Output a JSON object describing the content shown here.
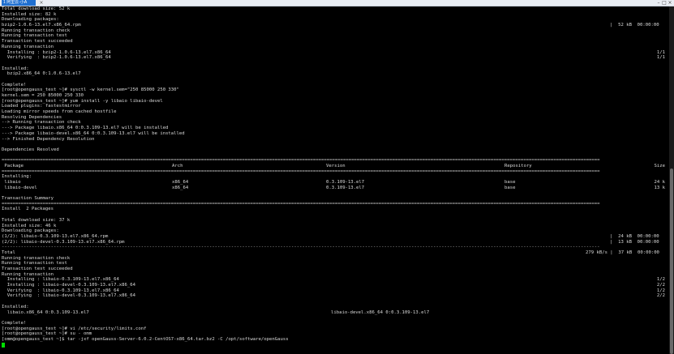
{
  "window": {
    "tab_title": "1 阿里云-小A",
    "tab_close": "×",
    "buttons": [
      "–",
      "□",
      "×"
    ]
  },
  "terminal": {
    "lines": [
      {
        "t": "Total download size: 52 k"
      },
      {
        "t": "Installed size: 82 k"
      },
      {
        "t": "Downloading packages:"
      },
      {
        "t": "bzip2-1.0.6-13.el7.x86_64.rpm",
        "c": [
          [
            750,
            "|  52 kB  00:00:00"
          ]
        ]
      },
      {
        "t": "Running transaction check"
      },
      {
        "t": "Running transaction test"
      },
      {
        "t": "Transaction test succeeded"
      },
      {
        "t": "Running transaction"
      },
      {
        "t": "  Installing : bzip2-1.0.6-13.el7.x86_64",
        "r": "1/1"
      },
      {
        "t": "  Verifying  : bzip2-1.0.6-13.el7.x86_64",
        "r": "1/1"
      },
      {
        "t": ""
      },
      {
        "t": "Installed:"
      },
      {
        "t": "  bzip2.x86_64 0:1.0.6-13.el7"
      },
      {
        "t": ""
      },
      {
        "t": "Complete!"
      },
      {
        "t": "[root@opengauss_test ~]# sysctl -w kernel.sem=\"250 85000 250 330\""
      },
      {
        "t": "kernel.sem = 250 85000 250 330"
      },
      {
        "t": "[root@opengauss_test ~]# yum install -y libaio libaio-devel"
      },
      {
        "t": "Loaded plugins: fastestmirror"
      },
      {
        "t": "Loading mirror speeds from cached hostfile"
      },
      {
        "t": "Resolving Dependencies"
      },
      {
        "t": "--> Running transaction check"
      },
      {
        "t": "---> Package libaio.x86_64 0:0.3.109-13.el7 will be installed"
      },
      {
        "t": "---> Package libaio-devel.x86_64 0:0.3.109-13.el7 will be installed"
      },
      {
        "t": "--> Finished Dependency Resolution"
      },
      {
        "t": ""
      },
      {
        "t": "Dependencies Resolved"
      },
      {
        "t": ""
      },
      {
        "t": "===========================================================================================================================================================================================================================",
        "sep": true
      },
      {
        "t": " Package",
        "c": [
          [
            210,
            "Arch"
          ],
          [
            400,
            "Version"
          ],
          [
            620,
            "Repository"
          ]
        ],
        "r": "Size"
      },
      {
        "t": "===========================================================================================================================================================================================================================",
        "sep": true
      },
      {
        "t": "Installing:"
      },
      {
        "t": " libaio",
        "c": [
          [
            210,
            "x86_64"
          ],
          [
            400,
            "0.3.109-13.el7"
          ],
          [
            620,
            "base"
          ]
        ],
        "r": "24 k"
      },
      {
        "t": " libaio-devel",
        "c": [
          [
            210,
            "x86_64"
          ],
          [
            400,
            "0.3.109-13.el7"
          ],
          [
            620,
            "base"
          ]
        ],
        "r": "13 k"
      },
      {
        "t": ""
      },
      {
        "t": "Transaction Summary"
      },
      {
        "t": "===========================================================================================================================================================================================================================",
        "sep": true
      },
      {
        "t": "Install  2 Packages"
      },
      {
        "t": ""
      },
      {
        "t": "Total download size: 37 k"
      },
      {
        "t": "Installed size: 46 k"
      },
      {
        "t": "Downloading packages:"
      },
      {
        "t": "(1/2): libaio-0.3.109-13.el7.x86_64.rpm",
        "c": [
          [
            750,
            "|  24 kB  00:00:00"
          ]
        ]
      },
      {
        "t": "(2/2): libaio-devel-0.3.109-13.el7.x86_64.rpm",
        "c": [
          [
            750,
            "|  13 kB  00:00:00"
          ]
        ]
      },
      {
        "t": "---------------------------------------------------------------------------------------------------------------------------------------------------------------------------------------------------------------------------",
        "sep": true
      },
      {
        "t": "Total",
        "c": [
          [
            720,
            "279 kB/s |  37 kB  00:00:00"
          ]
        ]
      },
      {
        "t": "Running transaction check"
      },
      {
        "t": "Running transaction test"
      },
      {
        "t": "Transaction test succeeded"
      },
      {
        "t": "Running transaction"
      },
      {
        "t": "  Installing : libaio-0.3.109-13.el7.x86_64",
        "r": "1/2"
      },
      {
        "t": "  Installing : libaio-devel-0.3.109-13.el7.x86_64",
        "r": "2/2"
      },
      {
        "t": "  Verifying  : libaio-0.3.109-13.el7.x86_64",
        "r": "1/2"
      },
      {
        "t": "  Verifying  : libaio-devel-0.3.109-13.el7.x86_64",
        "r": "2/2"
      },
      {
        "t": ""
      },
      {
        "t": "Installed:"
      },
      {
        "t": "  libaio.x86_64 0:0.3.109-13.el7",
        "c": [
          [
            406,
            "libaio-devel.x86_64 0:0.3.109-13.el7"
          ]
        ]
      },
      {
        "t": ""
      },
      {
        "t": "Complete!"
      },
      {
        "t": "[root@opengauss_test ~]# vi /etc/security/limits.conf"
      },
      {
        "t": "[root@opengauss_test ~]# su - omm"
      },
      {
        "t": "[omm@opengauss_test ~]$ tar -jxf openGauss-Server-6.0.2-CentOS7-x86_64.tar.bz2 -C /opt/software/openGauss"
      },
      {
        "t": "",
        "cursor": true
      }
    ]
  }
}
